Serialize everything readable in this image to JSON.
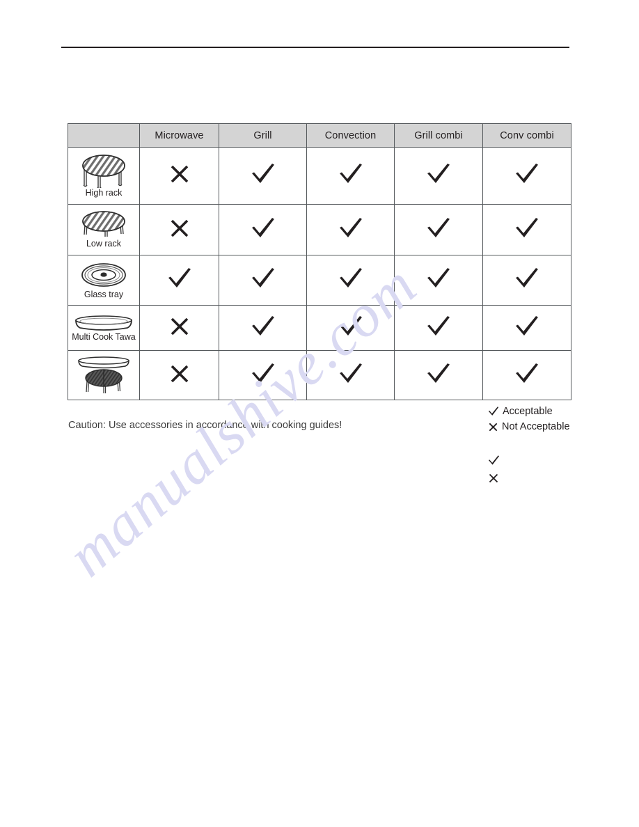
{
  "page": {
    "watermark_text": "manualshive.com",
    "rule_color": "#231f20"
  },
  "table": {
    "headers": [
      {
        "key": "accessory",
        "label": ""
      },
      {
        "key": "microwave",
        "label": "Microwave"
      },
      {
        "key": "grill",
        "label": "Grill"
      },
      {
        "key": "convection",
        "label": "Convection"
      },
      {
        "key": "grill_combi",
        "label": "Grill combi"
      },
      {
        "key": "conv_combi",
        "label": "Conv combi"
      }
    ],
    "header_bg": "#d4d4d4",
    "border_color": "#55595c",
    "rows": [
      {
        "accessory_label": "High rack",
        "accessory_icon": "high-rack-icon",
        "microwave": "cross",
        "grill": "check",
        "convection": "check",
        "grill_combi": "check",
        "conv_combi": "check"
      },
      {
        "accessory_label": "Low rack",
        "accessory_icon": "low-rack-icon",
        "microwave": "cross",
        "grill": "check",
        "convection": "check",
        "grill_combi": "check",
        "conv_combi": "check"
      },
      {
        "accessory_label": "Glass tray",
        "accessory_icon": "glass-tray-icon",
        "microwave": "check",
        "grill": "check",
        "convection": "check",
        "grill_combi": "check",
        "conv_combi": "check"
      },
      {
        "accessory_label": "Multi Cook Tawa",
        "accessory_icon": "multi-cook-tawa-icon",
        "microwave": "cross",
        "grill": "check",
        "convection": "check",
        "grill_combi": "check",
        "conv_combi": "check"
      },
      {
        "accessory_label": "",
        "accessory_icon": "tawa-on-low-rack-icon",
        "microwave": "cross",
        "grill": "check",
        "convection": "check",
        "grill_combi": "check",
        "conv_combi": "check"
      }
    ]
  },
  "caption": {
    "text": "Caution: Use accessories in accordance with cooking guides!"
  },
  "legend": {
    "items": [
      {
        "symbol": "check",
        "label": "Acceptable"
      },
      {
        "symbol": "cross",
        "label": "Not Acceptable"
      }
    ],
    "extra_symbols": [
      "check",
      "cross"
    ]
  }
}
